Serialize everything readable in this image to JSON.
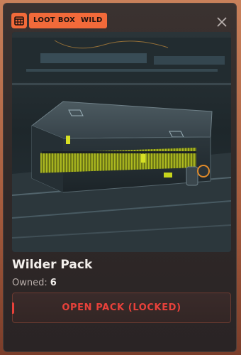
{
  "header": {
    "icon": "calendar-grid-icon",
    "tags": [
      "LOOT BOX",
      "WILD"
    ],
    "close_icon": "close-icon"
  },
  "item": {
    "name": "Wilder Pack",
    "owned_label": "Owned:",
    "owned_count": "6",
    "image": "armored-crate-image"
  },
  "action": {
    "label": "OPEN PACK (LOCKED)",
    "state": "locked"
  },
  "colors": {
    "accent": "#f26a3a",
    "danger": "#e8413a",
    "card_bg": "#302928"
  }
}
